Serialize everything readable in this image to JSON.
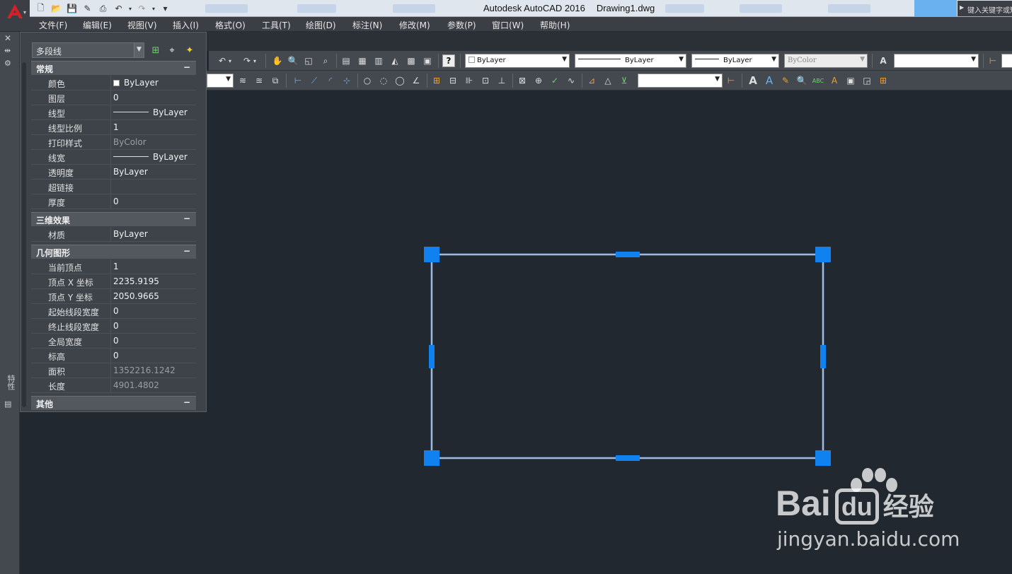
{
  "window": {
    "app_title": "Autodesk AutoCAD 2016",
    "file_name": "Drawing1.dwg",
    "search_placeholder": "键入关键字或短语"
  },
  "menu": [
    "文件(F)",
    "编辑(E)",
    "视图(V)",
    "插入(I)",
    "格式(O)",
    "工具(T)",
    "绘图(D)",
    "标注(N)",
    "修改(M)",
    "参数(P)",
    "窗口(W)",
    "帮助(H)"
  ],
  "toolbar": {
    "color_select": "ByLayer",
    "linetype_select": "ByLayer",
    "lineweight_select": "ByLayer",
    "plotstyle_select": "ByColor"
  },
  "left_strip": {
    "vertical_label": "特性"
  },
  "palette": {
    "object_type": "多段线",
    "sections": {
      "general": {
        "title": "常规",
        "toggle": "−",
        "rows": [
          {
            "key": "颜色",
            "value": "ByLayer",
            "swatch": true
          },
          {
            "key": "图层",
            "value": "0"
          },
          {
            "key": "线型",
            "value": "ByLayer",
            "line": true
          },
          {
            "key": "线型比例",
            "value": "1"
          },
          {
            "key": "打印样式",
            "value": "ByColor",
            "dim": true
          },
          {
            "key": "线宽",
            "value": "ByLayer",
            "line": true
          },
          {
            "key": "透明度",
            "value": "ByLayer"
          },
          {
            "key": "超链接",
            "value": ""
          },
          {
            "key": "厚度",
            "value": "0"
          }
        ]
      },
      "effects3d": {
        "title": "三维效果",
        "toggle": "−",
        "rows": [
          {
            "key": "材质",
            "value": "ByLayer"
          }
        ]
      },
      "geometry": {
        "title": "几何图形",
        "toggle": "−",
        "rows": [
          {
            "key": "当前顶点",
            "value": "1"
          },
          {
            "key": "顶点 X 坐标",
            "value": "2235.9195"
          },
          {
            "key": "顶点 Y 坐标",
            "value": "2050.9665"
          },
          {
            "key": "起始线段宽度",
            "value": "0"
          },
          {
            "key": "终止线段宽度",
            "value": "0"
          },
          {
            "key": "全局宽度",
            "value": "0"
          },
          {
            "key": "标高",
            "value": "0"
          },
          {
            "key": "面积",
            "value": "1352216.1242",
            "dim": true
          },
          {
            "key": "长度",
            "value": "4901.4802",
            "dim": true
          }
        ]
      },
      "other": {
        "title": "其他",
        "toggle": "−"
      }
    }
  },
  "watermark": {
    "brand": "Bai",
    "brand2": "du",
    "product": "经验",
    "url": "jingyan.baidu.com"
  },
  "colors": {
    "canvas": "#212830",
    "grip": "#0f82f0",
    "selection_line": "#cfe6ff"
  }
}
